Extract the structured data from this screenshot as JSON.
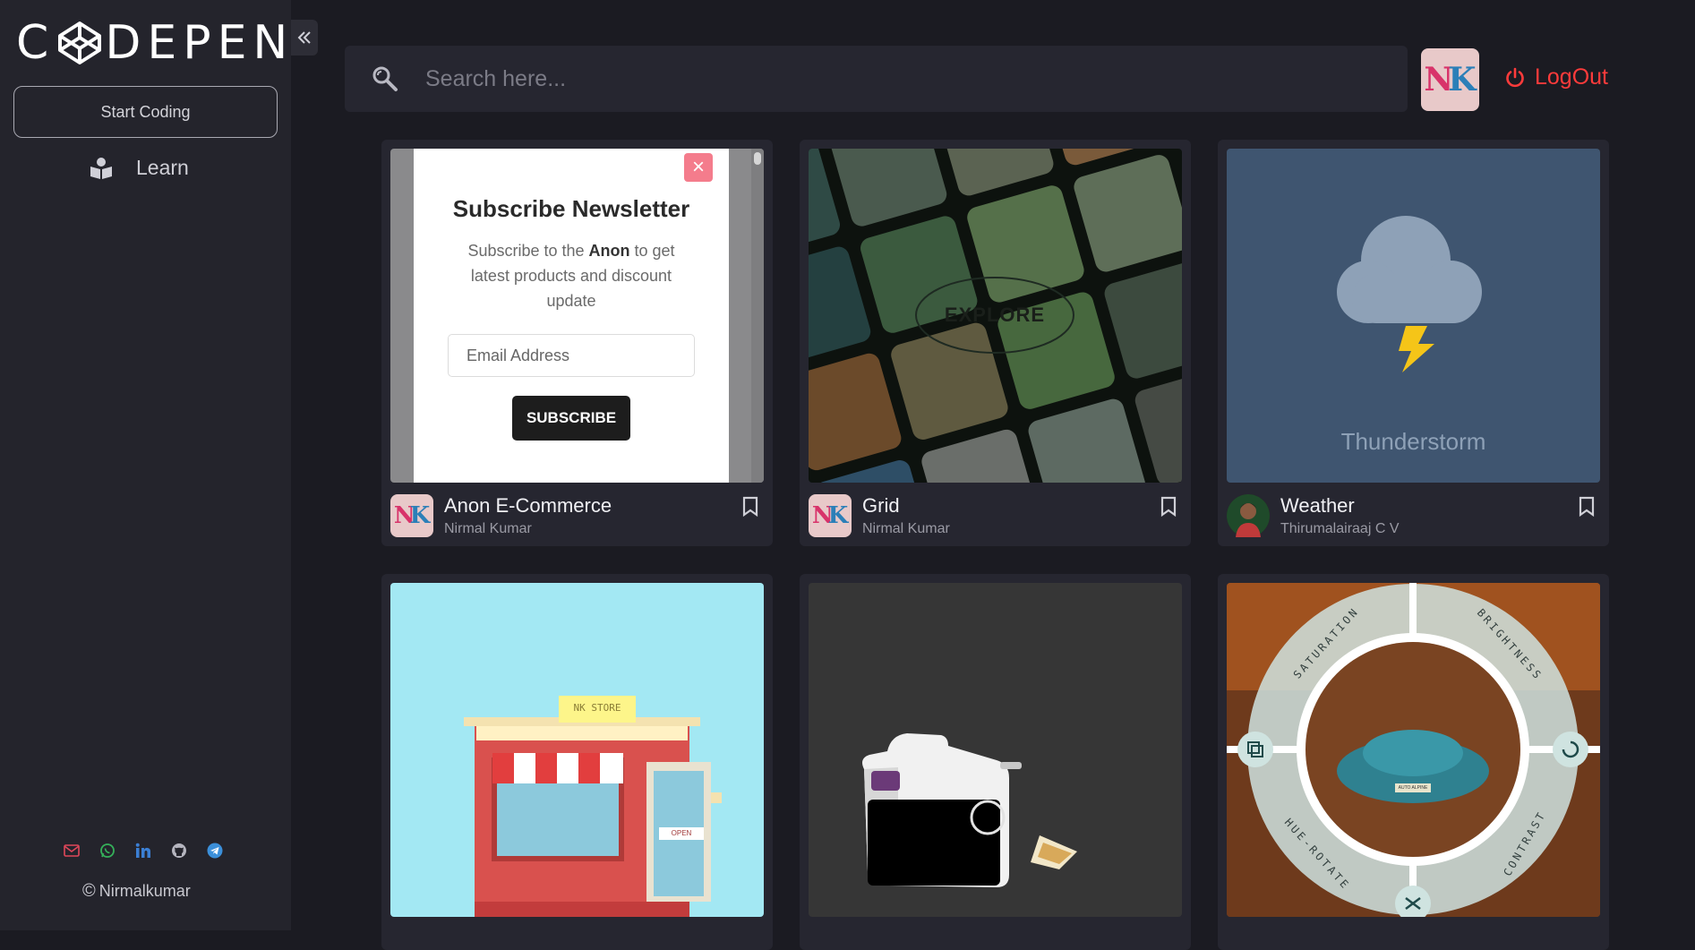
{
  "brand": {
    "logo_text_left": "C",
    "logo_text_right": "DEPEN"
  },
  "sidebar": {
    "start_label": "Start Coding",
    "learn_label": "Learn",
    "copyright": "Nirmalkumar",
    "socials": [
      "mail-icon",
      "whatsapp-icon",
      "linkedin-icon",
      "github-icon",
      "telegram-icon"
    ]
  },
  "search": {
    "placeholder": "Search here..."
  },
  "header": {
    "avatar_initials": "NK",
    "logout_label": "LogOut"
  },
  "colors": {
    "accent_red": "#ff3b3b",
    "bg": "#1b1b22",
    "panel": "#24242c"
  },
  "cards": [
    {
      "title": "Anon E-Commerce",
      "author": "Nirmal Kumar",
      "preview": {
        "heading": "Subscribe Newsletter",
        "text_before": "Subscribe to the ",
        "text_bold": "Anon",
        "text_after": " to get latest products and discount update",
        "email_placeholder": "Email Address",
        "button": "SUBSCRIBE",
        "close": "×"
      }
    },
    {
      "title": "Grid",
      "author": "Nirmal Kumar",
      "preview": {
        "button": "EXPLORE"
      }
    },
    {
      "title": "Weather",
      "author": "Thirumalairaaj C V",
      "preview": {
        "label": "Thunderstorm"
      }
    },
    {
      "title": "",
      "author": "",
      "preview": {
        "sign": "NK STORE",
        "door_sign": "OPEN"
      }
    },
    {
      "title": "",
      "author": "",
      "preview": {}
    },
    {
      "title": "",
      "author": "",
      "preview": {
        "labels": [
          "SATURATION",
          "BRIGHTNESS",
          "HUE-ROTATE",
          "CONTRAST"
        ],
        "plate": "AUTO ALPINE"
      }
    }
  ]
}
